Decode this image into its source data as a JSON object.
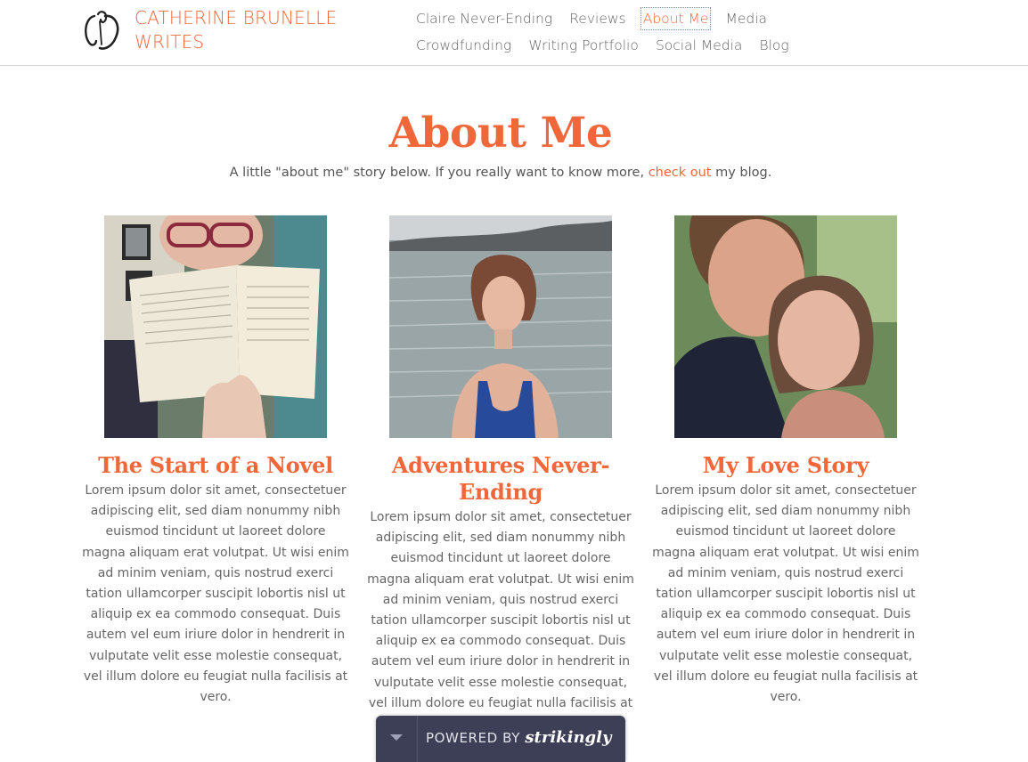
{
  "header": {
    "brand": "CATHERINE BRUNELLE WRITES",
    "nav": [
      {
        "label": "Claire Never-Ending",
        "active": false
      },
      {
        "label": "Reviews",
        "active": false
      },
      {
        "label": "About Me",
        "active": true
      },
      {
        "label": "Media",
        "active": false
      },
      {
        "label": "Crowdfunding",
        "active": false
      },
      {
        "label": "Writing Portfolio",
        "active": false
      },
      {
        "label": "Social Media",
        "active": false
      },
      {
        "label": "Blog",
        "active": false
      }
    ]
  },
  "main": {
    "title": "About Me",
    "subtitle_before": "A little \"about me\" story below. If you really want to know more, ",
    "subtitle_link": "check out",
    "subtitle_after": " my blog.",
    "columns": [
      {
        "heading": "The Start of a Novel",
        "body": "Lorem ipsum dolor sit amet, consectetuer adipiscing elit, sed diam nonummy nibh euismod tincidunt ut laoreet dolore magna aliquam erat volutpat. Ut wisi enim ad minim veniam, quis nostrud exerci tation ullamcorper suscipit lobortis nisl ut aliquip ex ea commodo consequat. Duis autem vel eum iriure dolor in hendrerit in vulputate velit esse molestie consequat, vel illum dolore eu feugiat nulla facilisis at vero."
      },
      {
        "heading": "Adventures Never-Ending",
        "body": "Lorem ipsum dolor sit amet, consectetuer adipiscing elit, sed diam nonummy nibh euismod tincidunt ut laoreet dolore magna aliquam erat volutpat. Ut wisi enim ad minim veniam, quis nostrud exerci tation ullamcorper suscipit lobortis nisl ut aliquip ex ea commodo consequat. Duis autem vel eum iriure dolor in hendrerit in vulputate velit esse molestie consequat, vel illum dolore eu feugiat nulla facilisis at vero."
      },
      {
        "heading": "My Love Story",
        "body": "Lorem ipsum dolor sit amet, consectetuer adipiscing elit, sed diam nonummy nibh euismod tincidunt ut laoreet dolore magna aliquam erat volutpat. Ut wisi enim ad minim veniam, quis nostrud exerci tation ullamcorper suscipit lobortis nisl ut aliquip ex ea commodo consequat. Duis autem vel eum iriure dolor in hendrerit in vulputate velit esse molestie consequat, vel illum dolore eu feugiat nulla facilisis at vero."
      }
    ]
  },
  "footer": {
    "powered_label": "POWERED BY",
    "powered_brand": "strikingly"
  },
  "colors": {
    "accent": "#f0673a",
    "badge_bg": "#3d3f56"
  }
}
